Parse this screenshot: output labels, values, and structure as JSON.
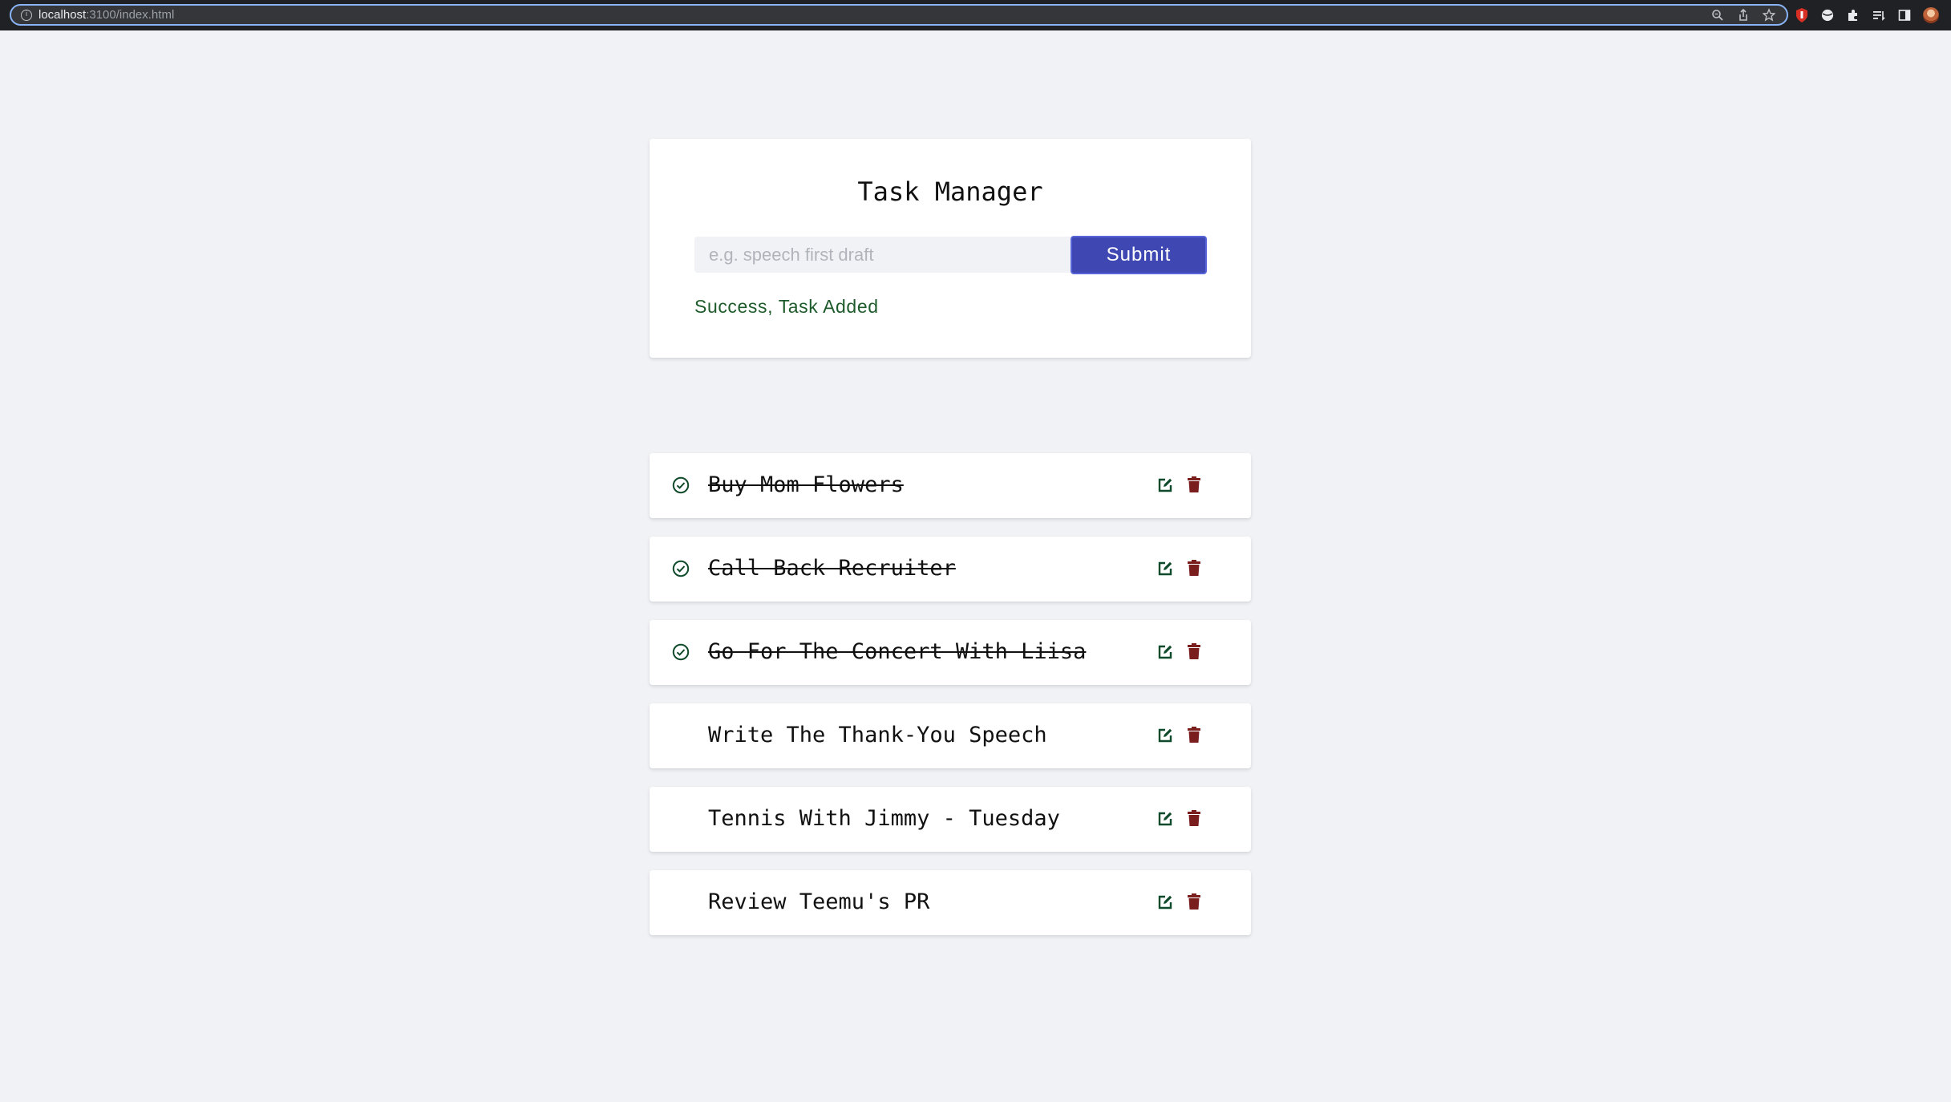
{
  "browser": {
    "url_host": "localhost",
    "url_path": ":3100/index.html"
  },
  "form": {
    "title": "Task Manager",
    "input_value": "",
    "input_placeholder": "e.g. speech first draft",
    "submit_label": "Submit",
    "alert": "Success, Task Added"
  },
  "tasks": [
    {
      "name": "Buy Mom Flowers",
      "completed": true
    },
    {
      "name": "Call Back Recruiter",
      "completed": true
    },
    {
      "name": "Go For The Concert With Liisa",
      "completed": true
    },
    {
      "name": "Write The Thank-You Speech",
      "completed": false
    },
    {
      "name": "Tennis With Jimmy - Tuesday",
      "completed": false
    },
    {
      "name": "Review Teemu's PR",
      "completed": false
    }
  ],
  "icons": {
    "check": "check-circle-icon",
    "edit": "edit-icon",
    "delete": "trash-icon"
  },
  "colors": {
    "background": "#f1f2f6",
    "primary": "#3f48b2",
    "success_text": "#1e5b2a",
    "edit_icon": "#0f4a2a",
    "delete_icon": "#7a1d1d"
  }
}
